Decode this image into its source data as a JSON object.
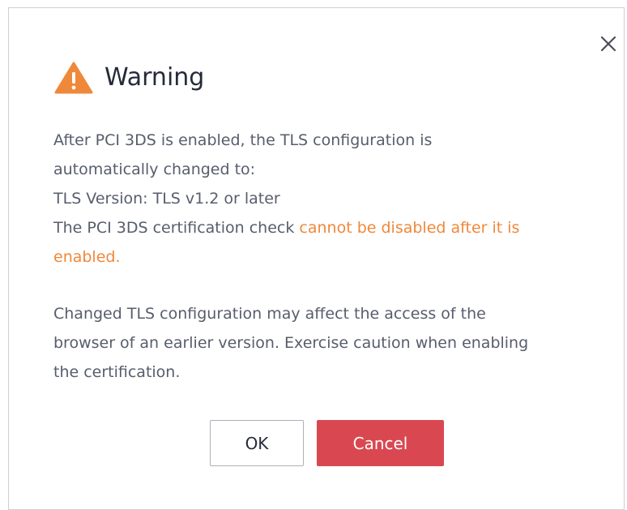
{
  "dialog": {
    "title": "Warning",
    "icon": "warning-triangle-icon",
    "close_icon": "close-icon",
    "paragraph1": {
      "line1": "After PCI 3DS is enabled, the TLS configuration is",
      "line2": "automatically changed to:",
      "line3": "TLS Version: TLS v1.2 or later",
      "line4_prefix": "The PCI 3DS certification check ",
      "line4_highlight_a": "cannot be disabled after it is",
      "line5_highlight_b": "enabled."
    },
    "paragraph2": {
      "line1": "Changed TLS configuration may affect the access of the",
      "line2": "browser of an earlier version. Exercise caution when enabling",
      "line3": "the certification."
    },
    "buttons": {
      "ok_label": "OK",
      "cancel_label": "Cancel"
    }
  },
  "colors": {
    "warning_icon": "#f0883a",
    "highlight_text": "#f0883a",
    "cancel_button": "#d94851",
    "body_text": "#575d6c",
    "title_text": "#252b3a"
  }
}
